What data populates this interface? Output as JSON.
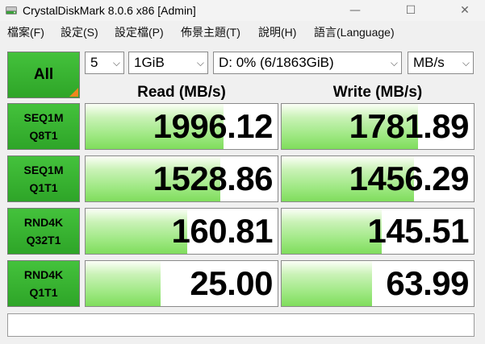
{
  "window": {
    "title": "CrystalDiskMark 8.0.6 x86 [Admin]",
    "controls": {
      "minimize": "—",
      "maximize": "☐",
      "close": "✕"
    }
  },
  "menu": {
    "items": [
      "檔案(F)",
      "設定(S)",
      "設定檔(P)",
      "佈景主題(T)",
      "說明(H)",
      "語言(Language)"
    ]
  },
  "toolbar": {
    "all_label": "All",
    "count": "5",
    "size": "1GiB",
    "drive": "D: 0% (6/1863GiB)",
    "unit": "MB/s"
  },
  "headers": {
    "read": "Read (MB/s)",
    "write": "Write (MB/s)"
  },
  "tests": [
    {
      "line1": "SEQ1M",
      "line2": "Q8T1",
      "read": "1996.12",
      "write": "1781.89",
      "read_fill": 0.72,
      "write_fill": 0.71
    },
    {
      "line1": "SEQ1M",
      "line2": "Q1T1",
      "read": "1528.86",
      "write": "1456.29",
      "read_fill": 0.7,
      "write_fill": 0.69
    },
    {
      "line1": "RND4K",
      "line2": "Q32T1",
      "read": "160.81",
      "write": "145.51",
      "read_fill": 0.53,
      "write_fill": 0.52
    },
    {
      "line1": "RND4K",
      "line2": "Q1T1",
      "read": "25.00",
      "write": "63.99",
      "read_fill": 0.39,
      "write_fill": 0.47
    }
  ],
  "status": "",
  "colors": {
    "button_green": "#3cb534",
    "bar_green": "#8ee46b",
    "corner_orange": "#f0861e"
  }
}
